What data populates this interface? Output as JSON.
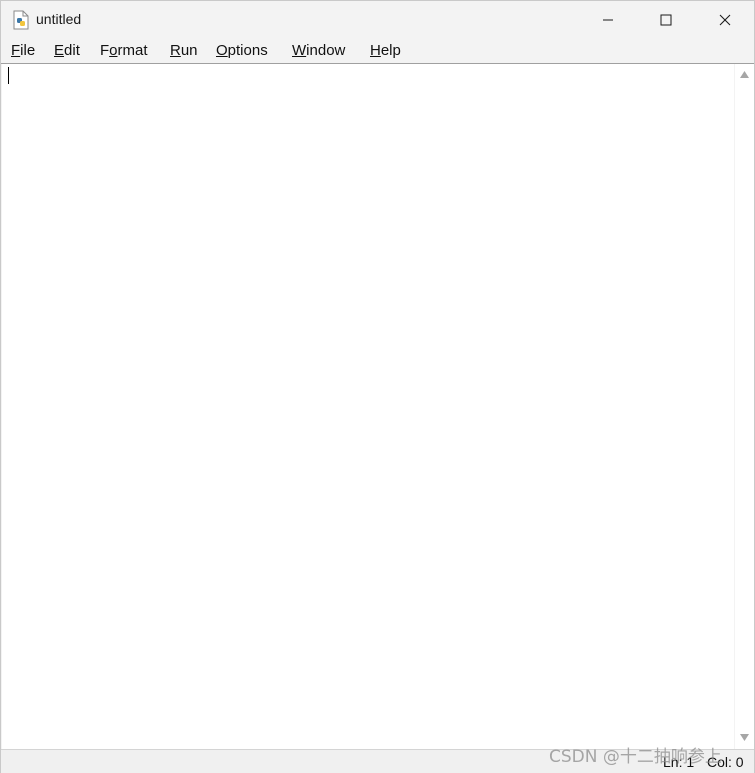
{
  "window": {
    "title": "untitled",
    "app_icon": "python-file-icon",
    "controls": {
      "minimize_icon": "minimize-icon",
      "maximize_icon": "maximize-icon",
      "close_icon": "close-icon"
    }
  },
  "menubar": {
    "items": [
      {
        "label_pre": "",
        "mnemonic": "F",
        "label_post": "ile"
      },
      {
        "label_pre": "",
        "mnemonic": "E",
        "label_post": "dit"
      },
      {
        "label_pre": "F",
        "mnemonic": "o",
        "label_post": "rmat"
      },
      {
        "label_pre": "",
        "mnemonic": "R",
        "label_post": "un"
      },
      {
        "label_pre": "",
        "mnemonic": "O",
        "label_post": "ptions"
      },
      {
        "label_pre": "",
        "mnemonic": "W",
        "label_post": "indow"
      },
      {
        "label_pre": "",
        "mnemonic": "H",
        "label_post": "elp"
      }
    ]
  },
  "editor": {
    "content": ""
  },
  "statusbar": {
    "line": "Ln: 1",
    "column": "Col: 0"
  },
  "watermark": "CSDN @十二抽响参上",
  "colors": {
    "chrome": "#f3f3f3",
    "editor_bg": "#ffffff",
    "text": "#111111"
  }
}
